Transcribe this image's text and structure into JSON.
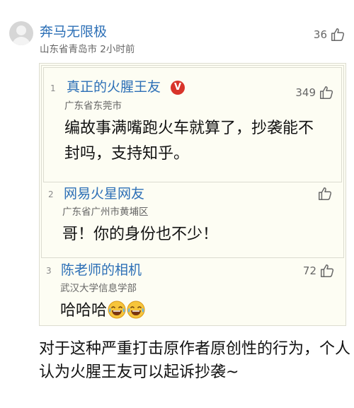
{
  "comment": {
    "username": "奔马无限极",
    "location_time": "山东省青岛市 2小时前",
    "likes": "36",
    "replies": [
      {
        "floor": "1",
        "username": "真正的火腥王友",
        "verified_badge": "V",
        "location": "广东省东莞市",
        "likes": "349",
        "text": "编故事满嘴跑火车就算了，抄袭能不封吗，支持知乎。"
      },
      {
        "floor": "2",
        "username": "网易火星网友",
        "location": "广东省广州市黄埔区",
        "likes": "",
        "text": "哥！你的身份也不少！"
      },
      {
        "floor": "3",
        "username": "陈老师的相机",
        "location": "武汉大学信息学部",
        "likes": "72",
        "text": "哈哈哈",
        "emojis": [
          "laughing-crying-emoji",
          "laughing-crying-emoji"
        ]
      }
    ],
    "body_text": "对于这种严重打击原作者原创性的行为，个人认为火腥王友可以起诉抄袭~"
  },
  "colors": {
    "username": "#2c6fb6",
    "meta": "#666666",
    "quote_bg": "#fdfdf3",
    "quote_border": "#dcdcd0",
    "verified": "#d8342a"
  },
  "icons": {
    "like": "thumb-up-icon",
    "avatar": "default-avatar-icon",
    "verified": "verified-v-icon"
  }
}
